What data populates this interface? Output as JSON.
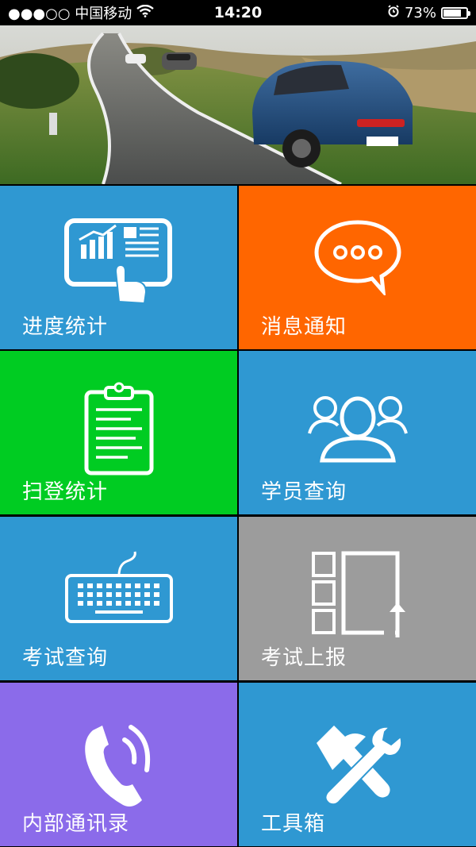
{
  "status_bar": {
    "carrier": "●●●○○ 中国移动",
    "time": "14:20",
    "battery_percent": "73%",
    "battery_level": 0.73,
    "icons": [
      "wifi-icon",
      "alarm-icon",
      "battery-icon"
    ]
  },
  "banner": {
    "image": "porsche-road-photo"
  },
  "colors": {
    "blue": "#2f98d2",
    "orange": "#ff6600",
    "green": "#00cc22",
    "gray": "#9c9c9c",
    "purple": "#8b6bea"
  },
  "tiles": [
    {
      "label": "进度统计",
      "icon": "tablet-chart-icon",
      "color": "#2f98d2"
    },
    {
      "label": "消息通知",
      "icon": "chat-bubble-icon",
      "color": "#ff6600"
    },
    {
      "label": "扫登统计",
      "icon": "clipboard-icon",
      "color": "#00cc22"
    },
    {
      "label": "学员查询",
      "icon": "users-icon",
      "color": "#2f98d2"
    },
    {
      "label": "考试查询",
      "icon": "keyboard-icon",
      "color": "#2f98d2"
    },
    {
      "label": "考试上报",
      "icon": "upload-layout-icon",
      "color": "#9c9c9c"
    },
    {
      "label": "内部通讯录",
      "icon": "phone-icon",
      "color": "#8b6bea"
    },
    {
      "label": "工具箱",
      "icon": "tools-icon",
      "color": "#2f98d2"
    }
  ]
}
